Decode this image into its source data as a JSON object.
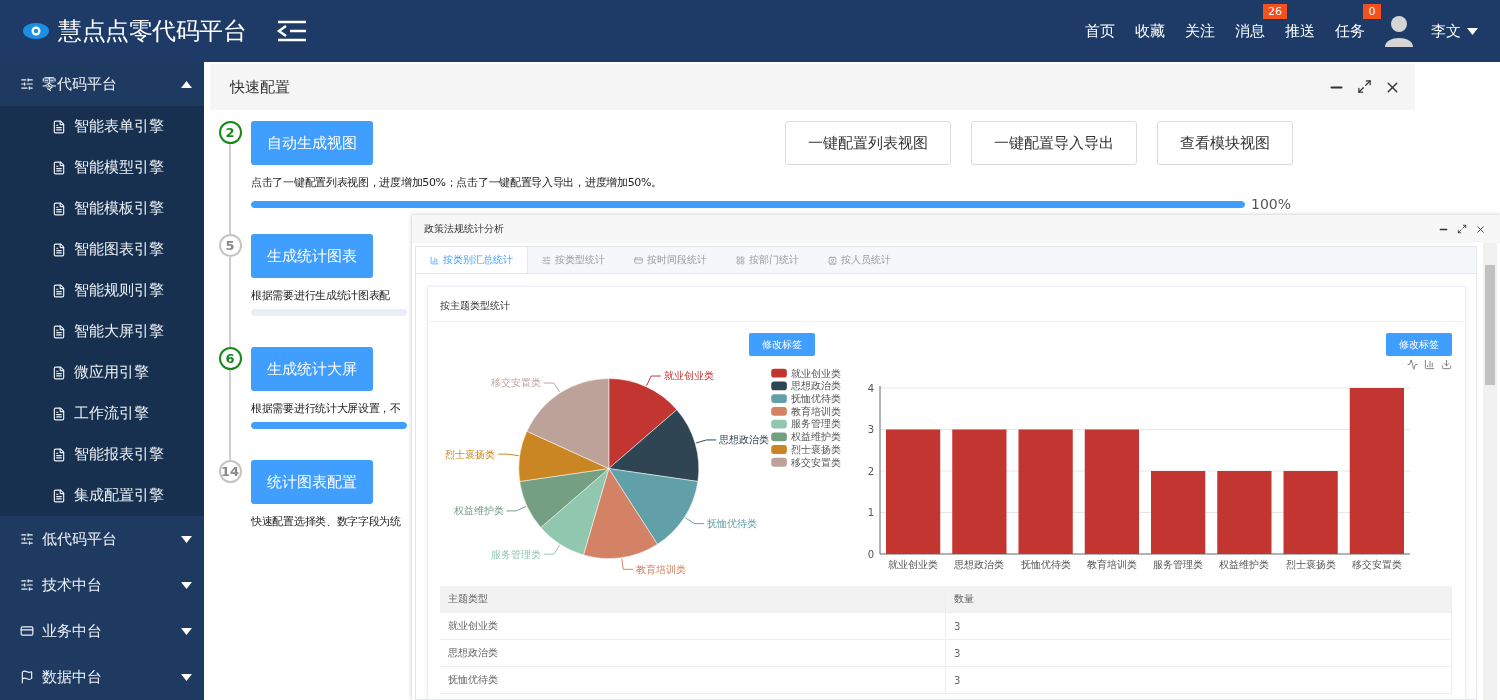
{
  "header": {
    "title": "慧点点零代码平台",
    "nav": [
      {
        "label": "首页"
      },
      {
        "label": "收藏"
      },
      {
        "label": "关注"
      },
      {
        "label": "消息",
        "badge": "26"
      },
      {
        "label": "推送"
      },
      {
        "label": "任务",
        "badge": "0"
      }
    ],
    "user": "李文"
  },
  "sidebar": {
    "groups": [
      {
        "label": "零代码平台",
        "expanded": true,
        "children": [
          {
            "label": "智能表单引擎"
          },
          {
            "label": "智能模型引擎"
          },
          {
            "label": "智能模板引擎"
          },
          {
            "label": "智能图表引擎"
          },
          {
            "label": "智能规则引擎"
          },
          {
            "label": "智能大屏引擎"
          },
          {
            "label": "微应用引擎"
          },
          {
            "label": "工作流引擎"
          },
          {
            "label": "智能报表引擎"
          },
          {
            "label": "集成配置引擎"
          }
        ]
      },
      {
        "label": "低代码平台",
        "expanded": false
      },
      {
        "label": "技术中台",
        "expanded": false
      },
      {
        "label": "业务中台",
        "expanded": false
      },
      {
        "label": "数据中台",
        "expanded": false
      }
    ]
  },
  "panel": {
    "title": "快速配置",
    "quick_buttons": [
      "一键配置列表视图",
      "一键配置导入导出",
      "查看模块视图"
    ],
    "steps": [
      {
        "number": "2",
        "done": true,
        "button": "自动生成视图",
        "description": "点击了一键配置列表视图，进度增加50%；点击了一键配置导入导出，进度增加50%。",
        "level": 1,
        "reading": "100%"
      },
      {
        "number": "5",
        "done": false,
        "button": "生成统计图表",
        "description": "根据需要进行生成统计图表配",
        "level": 0
      },
      {
        "number": "6",
        "done": true,
        "button": "生成统计大屏",
        "description": "根据需要进行统计大屏设置，不",
        "level": 1
      },
      {
        "number": "14",
        "done": false,
        "button": "统计图表配置",
        "description": "快速配置选择类、数字字段为统"
      }
    ]
  },
  "stats_window": {
    "title": "政策法规统计分析",
    "tabs": [
      {
        "label": "按类别汇总统计",
        "selected": true
      },
      {
        "label": "按类型统计",
        "selected": false
      },
      {
        "label": "按时间段统计",
        "selected": false
      },
      {
        "label": "按部门统计",
        "selected": false
      },
      {
        "label": "按人员统计",
        "selected": false
      }
    ],
    "card_title": "按主题类型统计",
    "pie": {
      "button": "修改标签",
      "chart_data": {
        "type": "pie",
        "categories": [
          "就业创业类",
          "思想政治类",
          "抚恤优待类",
          "教育培训类",
          "服务管理类",
          "权益维护类",
          "烈士褒扬类",
          "移交安置类"
        ],
        "colors": [
          "#c23531",
          "#2f4554",
          "#61a0a8",
          "#d48265",
          "#91c7ae",
          "#749f83",
          "#ca8622",
          "#bda29a"
        ],
        "values": [
          13.64,
          13.64,
          13.63,
          13.63,
          9.09,
          9.09,
          9.09,
          18.19
        ],
        "legend": "right"
      }
    },
    "bar": {
      "button": "修改标签",
      "chart_data": {
        "type": "bar",
        "categories": [
          "就业创业类",
          "思想政治类",
          "抚恤优待类",
          "教育培训类",
          "服务管理类",
          "权益维护类",
          "烈士褒扬类",
          "移交安置类"
        ],
        "values": [
          3,
          3,
          3,
          3,
          2,
          2,
          2,
          4
        ],
        "color": "#c23531",
        "ylim": [
          0,
          4
        ],
        "yticks": [
          0,
          1,
          2,
          3,
          4
        ],
        "grid": true
      }
    },
    "table": {
      "columns": [
        "主题类型",
        "数量"
      ],
      "rows": [
        [
          "就业创业类",
          "3"
        ],
        [
          "思想政治类",
          "3"
        ],
        [
          "抚恤优待类",
          "3"
        ]
      ]
    }
  }
}
